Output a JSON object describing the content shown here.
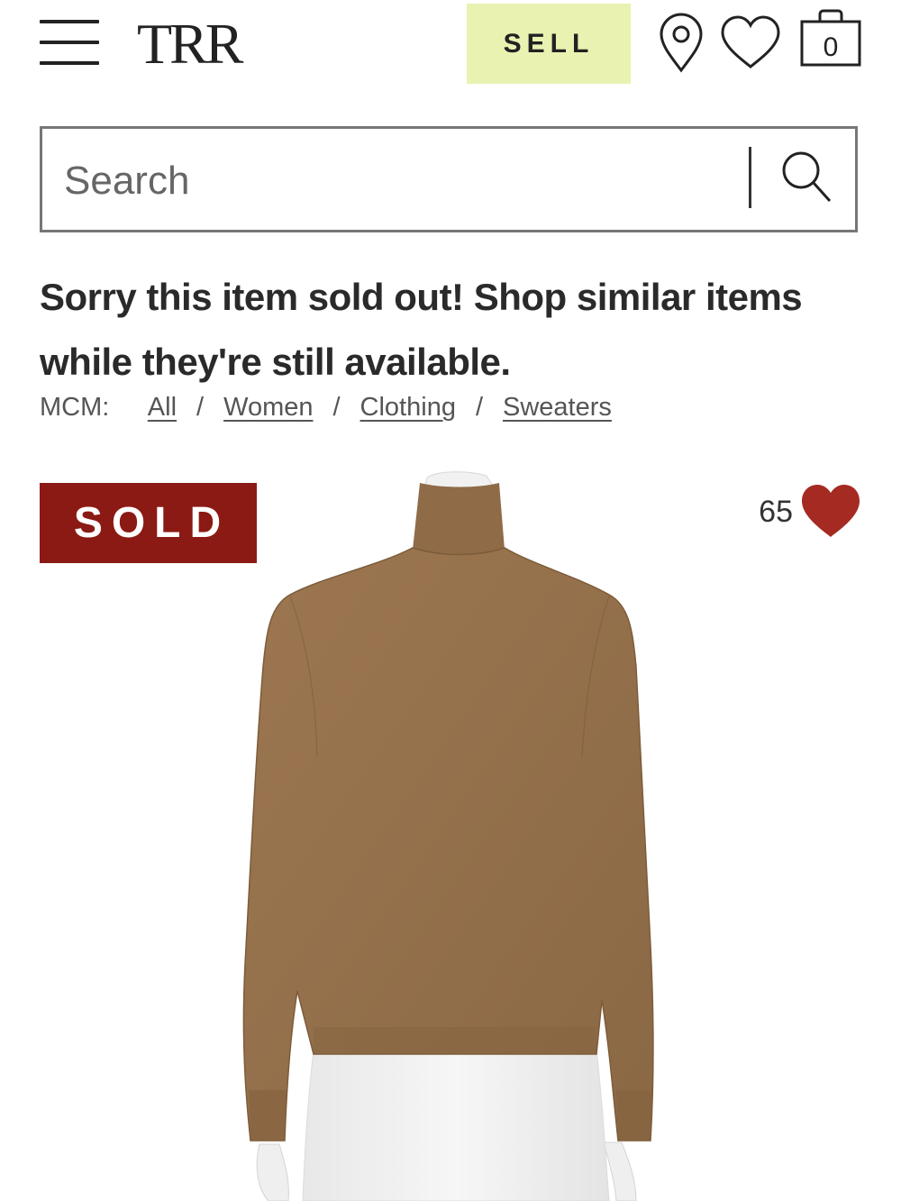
{
  "header": {
    "logo": "TRR",
    "sell_label": "SELL",
    "bag_count": "0",
    "icons": {
      "menu": "hamburger-menu-icon",
      "location": "location-pin-icon",
      "wishlist": "heart-outline-icon",
      "bag": "shopping-bag-icon"
    },
    "sell_color": "#e9f2b0"
  },
  "search": {
    "placeholder": "Search",
    "value": "",
    "icon": "search-icon"
  },
  "message": "Sorry this item sold out! Shop similar items while they're still available.",
  "breadcrumb": {
    "brand": "MCM:",
    "items": [
      "All",
      "Women",
      "Clothing",
      "Sweaters"
    ],
    "separator": "/"
  },
  "product": {
    "status_badge": "SOLD",
    "badge_color": "#8b1a14",
    "favorite_count": "65",
    "heart_color": "#a52a22",
    "image_icon": "sweater-on-mannequin-image"
  }
}
